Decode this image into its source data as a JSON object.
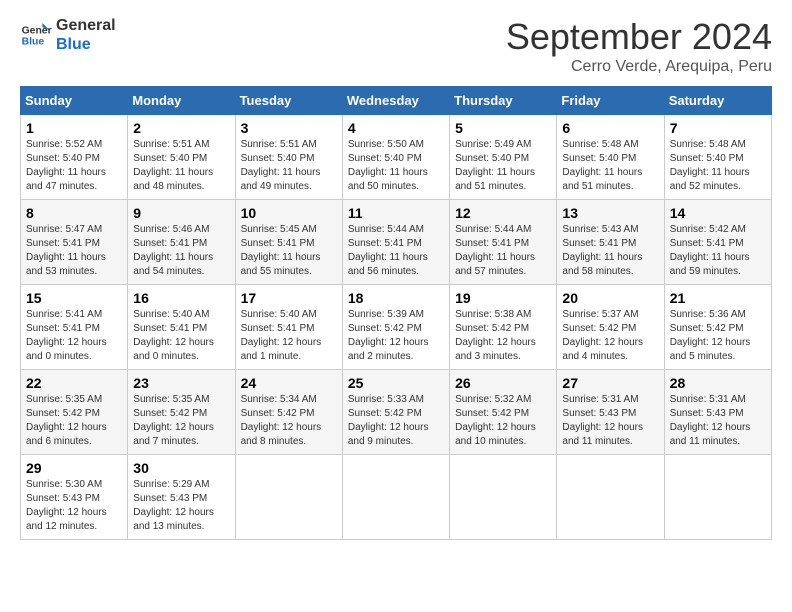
{
  "header": {
    "logo_line1": "General",
    "logo_line2": "Blue",
    "month_title": "September 2024",
    "location": "Cerro Verde, Arequipa, Peru"
  },
  "weekdays": [
    "Sunday",
    "Monday",
    "Tuesday",
    "Wednesday",
    "Thursday",
    "Friday",
    "Saturday"
  ],
  "weeks": [
    [
      {
        "day": "1",
        "info": "Sunrise: 5:52 AM\nSunset: 5:40 PM\nDaylight: 11 hours and 47 minutes."
      },
      {
        "day": "2",
        "info": "Sunrise: 5:51 AM\nSunset: 5:40 PM\nDaylight: 11 hours and 48 minutes."
      },
      {
        "day": "3",
        "info": "Sunrise: 5:51 AM\nSunset: 5:40 PM\nDaylight: 11 hours and 49 minutes."
      },
      {
        "day": "4",
        "info": "Sunrise: 5:50 AM\nSunset: 5:40 PM\nDaylight: 11 hours and 50 minutes."
      },
      {
        "day": "5",
        "info": "Sunrise: 5:49 AM\nSunset: 5:40 PM\nDaylight: 11 hours and 51 minutes."
      },
      {
        "day": "6",
        "info": "Sunrise: 5:48 AM\nSunset: 5:40 PM\nDaylight: 11 hours and 51 minutes."
      },
      {
        "day": "7",
        "info": "Sunrise: 5:48 AM\nSunset: 5:40 PM\nDaylight: 11 hours and 52 minutes."
      }
    ],
    [
      {
        "day": "8",
        "info": "Sunrise: 5:47 AM\nSunset: 5:41 PM\nDaylight: 11 hours and 53 minutes."
      },
      {
        "day": "9",
        "info": "Sunrise: 5:46 AM\nSunset: 5:41 PM\nDaylight: 11 hours and 54 minutes."
      },
      {
        "day": "10",
        "info": "Sunrise: 5:45 AM\nSunset: 5:41 PM\nDaylight: 11 hours and 55 minutes."
      },
      {
        "day": "11",
        "info": "Sunrise: 5:44 AM\nSunset: 5:41 PM\nDaylight: 11 hours and 56 minutes."
      },
      {
        "day": "12",
        "info": "Sunrise: 5:44 AM\nSunset: 5:41 PM\nDaylight: 11 hours and 57 minutes."
      },
      {
        "day": "13",
        "info": "Sunrise: 5:43 AM\nSunset: 5:41 PM\nDaylight: 11 hours and 58 minutes."
      },
      {
        "day": "14",
        "info": "Sunrise: 5:42 AM\nSunset: 5:41 PM\nDaylight: 11 hours and 59 minutes."
      }
    ],
    [
      {
        "day": "15",
        "info": "Sunrise: 5:41 AM\nSunset: 5:41 PM\nDaylight: 12 hours and 0 minutes."
      },
      {
        "day": "16",
        "info": "Sunrise: 5:40 AM\nSunset: 5:41 PM\nDaylight: 12 hours and 0 minutes."
      },
      {
        "day": "17",
        "info": "Sunrise: 5:40 AM\nSunset: 5:41 PM\nDaylight: 12 hours and 1 minute."
      },
      {
        "day": "18",
        "info": "Sunrise: 5:39 AM\nSunset: 5:42 PM\nDaylight: 12 hours and 2 minutes."
      },
      {
        "day": "19",
        "info": "Sunrise: 5:38 AM\nSunset: 5:42 PM\nDaylight: 12 hours and 3 minutes."
      },
      {
        "day": "20",
        "info": "Sunrise: 5:37 AM\nSunset: 5:42 PM\nDaylight: 12 hours and 4 minutes."
      },
      {
        "day": "21",
        "info": "Sunrise: 5:36 AM\nSunset: 5:42 PM\nDaylight: 12 hours and 5 minutes."
      }
    ],
    [
      {
        "day": "22",
        "info": "Sunrise: 5:35 AM\nSunset: 5:42 PM\nDaylight: 12 hours and 6 minutes."
      },
      {
        "day": "23",
        "info": "Sunrise: 5:35 AM\nSunset: 5:42 PM\nDaylight: 12 hours and 7 minutes."
      },
      {
        "day": "24",
        "info": "Sunrise: 5:34 AM\nSunset: 5:42 PM\nDaylight: 12 hours and 8 minutes."
      },
      {
        "day": "25",
        "info": "Sunrise: 5:33 AM\nSunset: 5:42 PM\nDaylight: 12 hours and 9 minutes."
      },
      {
        "day": "26",
        "info": "Sunrise: 5:32 AM\nSunset: 5:42 PM\nDaylight: 12 hours and 10 minutes."
      },
      {
        "day": "27",
        "info": "Sunrise: 5:31 AM\nSunset: 5:43 PM\nDaylight: 12 hours and 11 minutes."
      },
      {
        "day": "28",
        "info": "Sunrise: 5:31 AM\nSunset: 5:43 PM\nDaylight: 12 hours and 11 minutes."
      }
    ],
    [
      {
        "day": "29",
        "info": "Sunrise: 5:30 AM\nSunset: 5:43 PM\nDaylight: 12 hours and 12 minutes."
      },
      {
        "day": "30",
        "info": "Sunrise: 5:29 AM\nSunset: 5:43 PM\nDaylight: 12 hours and 13 minutes."
      },
      {
        "day": "",
        "info": ""
      },
      {
        "day": "",
        "info": ""
      },
      {
        "day": "",
        "info": ""
      },
      {
        "day": "",
        "info": ""
      },
      {
        "day": "",
        "info": ""
      }
    ]
  ]
}
